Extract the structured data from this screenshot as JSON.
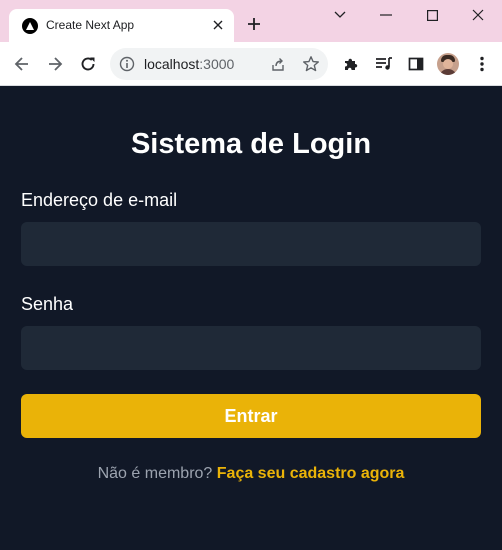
{
  "browser": {
    "tab_title": "Create Next App",
    "url_host": "localhost",
    "url_port": ":3000",
    "accent_titlebar": "#f3d3e4",
    "icons": {
      "tab_favicon": "triangle-logo-icon",
      "tab_close": "close-icon",
      "new_tab": "plus-icon",
      "minimize": "minimize-icon",
      "maximize": "maximize-icon",
      "window_close": "close-icon",
      "tab_search": "chevron-down-icon",
      "back": "arrow-left-icon",
      "forward": "arrow-right-icon",
      "reload": "reload-icon",
      "site_info": "info-icon",
      "share": "share-icon",
      "bookmark": "star-icon",
      "extensions": "puzzle-icon",
      "media": "playlist-icon",
      "side_panel": "side-panel-icon",
      "profile": "avatar",
      "menu": "kebab-menu-icon"
    }
  },
  "login": {
    "title": "Sistema de Login",
    "email_label": "Endereço de e-mail",
    "email_value": "",
    "password_label": "Senha",
    "password_value": "",
    "submit_label": "Entrar",
    "footer_text": "Não é membro?",
    "footer_link": "Faça seu cadastro agora",
    "colors": {
      "background": "#111827",
      "input": "#1f2937",
      "accent": "#eab308"
    }
  }
}
